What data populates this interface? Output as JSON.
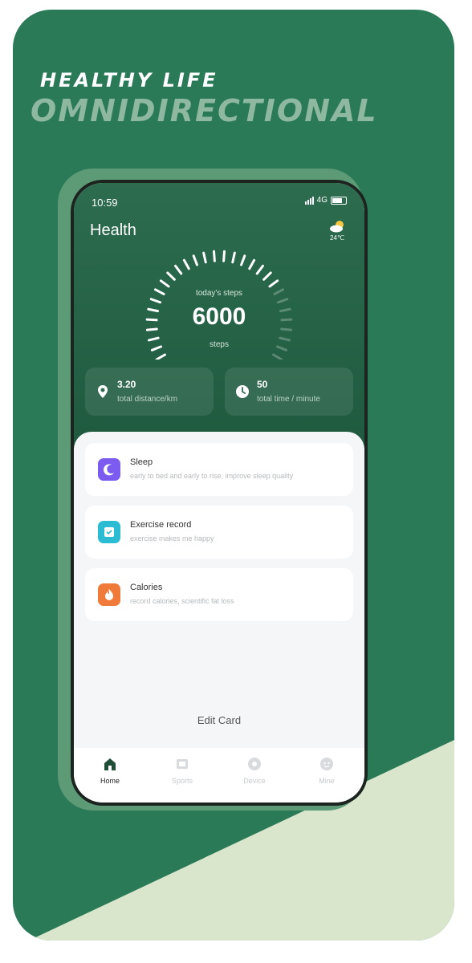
{
  "promo": {
    "headline_line1": "HEALTHY LIFE",
    "headline_line2": "OMNIDIRECTIONAL",
    "colors": {
      "background": "#2a7a58",
      "wedge": "#d9e6cc",
      "headline2": "#8fb8a1"
    }
  },
  "status_bar": {
    "time": "10:59",
    "network": "4G"
  },
  "header": {
    "title": "Health",
    "weather_icon": "cloud-sun-icon",
    "weather_temp": "24℃"
  },
  "steps": {
    "caption": "today's steps",
    "value": "6000",
    "unit": "steps",
    "progress": 0.75
  },
  "stats": [
    {
      "icon": "location-pin-icon",
      "value": "3.20",
      "label": "total distance/km"
    },
    {
      "icon": "clock-icon",
      "value": "50",
      "label": "total time / minute"
    }
  ],
  "cards": [
    {
      "icon": "moon-icon",
      "color": "#7c5cf0",
      "title": "Sleep",
      "subtitle": "early to bed and early to rise, improve sleep quality"
    },
    {
      "icon": "calendar-check-icon",
      "color": "#2bbcd4",
      "title": "Exercise record",
      "subtitle": "exercise makes me happy"
    },
    {
      "icon": "flame-icon",
      "color": "#f07a3a",
      "title": "Calories",
      "subtitle": "record calories,  scientific fat loss"
    }
  ],
  "edit_card_label": "Edit Card",
  "tabs": [
    {
      "label": "Home",
      "icon": "home-icon",
      "active": true
    },
    {
      "label": "Sports",
      "icon": "sports-icon",
      "active": false
    },
    {
      "label": "Device",
      "icon": "device-icon",
      "active": false
    },
    {
      "label": "Mine",
      "icon": "profile-icon",
      "active": false
    }
  ]
}
